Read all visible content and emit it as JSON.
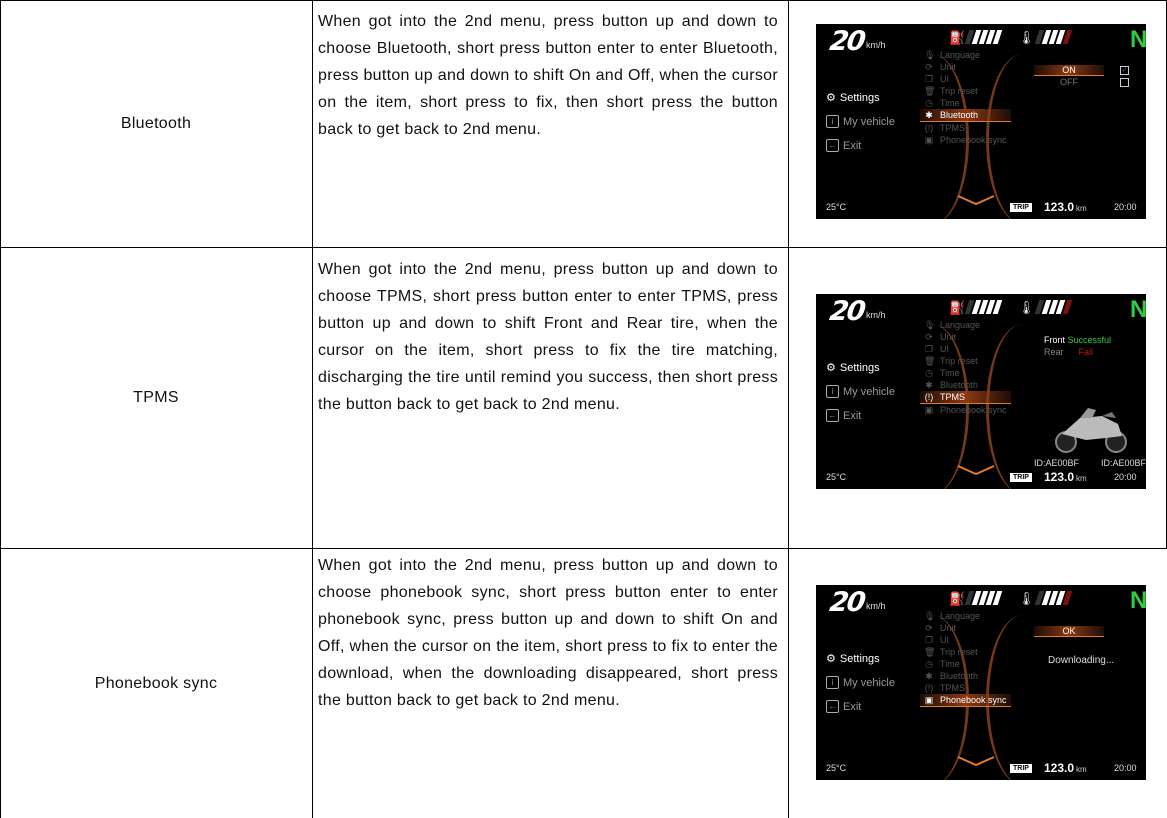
{
  "rows": [
    {
      "feature": "Bluetooth",
      "description": "When got into the 2nd menu, press button up and down to choose Bluetooth, short press button enter to enter Bluetooth, press button up and down to shift On and Off, when the cursor on the item, short press to fix, then short press the button back to get back to 2nd menu.",
      "screen": {
        "speed": "20",
        "speed_unit": "km/h",
        "gear": "N",
        "left_menu": [
          "Settings",
          "My vehicle",
          "Exit"
        ],
        "mid_menu": [
          "Language",
          "Unit",
          "UI",
          "Trip reset",
          "Time",
          "Bluetooth",
          "TPMS",
          "Phonebook sync"
        ],
        "active_item": "Bluetooth",
        "options": [
          "ON",
          "OFF"
        ],
        "temperature": "25°C",
        "trip_label": "TRIP",
        "trip_value": "123.0",
        "trip_unit": "km",
        "clock": "20:00"
      }
    },
    {
      "feature": "TPMS",
      "description": "When got into the 2nd menu, press button up and down to choose TPMS, short press button enter to enter TPMS, press button up and down to shift Front and Rear tire, when the cursor on the item, short press to fix the tire matching, discharging the tire until remind you success, then short press the button back to get back to 2nd menu.",
      "screen": {
        "speed": "20",
        "speed_unit": "km/h",
        "gear": "N",
        "left_menu": [
          "Settings",
          "My vehicle",
          "Exit"
        ],
        "mid_menu": [
          "Language",
          "Unit",
          "UI",
          "Trip reset",
          "Time",
          "Bluetooth",
          "TPMS",
          "Phonebook sync"
        ],
        "active_item": "TPMS",
        "front_label": "Front",
        "front_status": "Successful",
        "rear_label": "Rear",
        "rear_status": "Fail",
        "front_id": "ID:AE00BF",
        "rear_id": "ID:AE00BF",
        "temperature": "25°C",
        "trip_label": "TRIP",
        "trip_value": "123.0",
        "trip_unit": "km",
        "clock": "20:00"
      }
    },
    {
      "feature": "Phonebook sync",
      "description": "When got into the 2nd menu, press button up and down to choose phonebook sync, short press button enter to enter phonebook sync, press button up and down to shift On and Off, when the cursor on the item, short press to fix to enter the download, when the downloading disappeared, short press the button back to get back to 2nd menu.",
      "screen": {
        "speed": "20",
        "speed_unit": "km/h",
        "gear": "N",
        "left_menu": [
          "Settings",
          "My vehicle",
          "Exit"
        ],
        "mid_menu": [
          "Language",
          "Unit",
          "UI",
          "Trip reset",
          "Time",
          "Bluetooth",
          "TPMS",
          "Phonebook sync"
        ],
        "active_item": "Phonebook sync",
        "ok_label": "OK",
        "status_text": "Downloading...",
        "temperature": "25°C",
        "trip_label": "TRIP",
        "trip_value": "123.0",
        "trip_unit": "km",
        "clock": "20:00"
      }
    }
  ]
}
